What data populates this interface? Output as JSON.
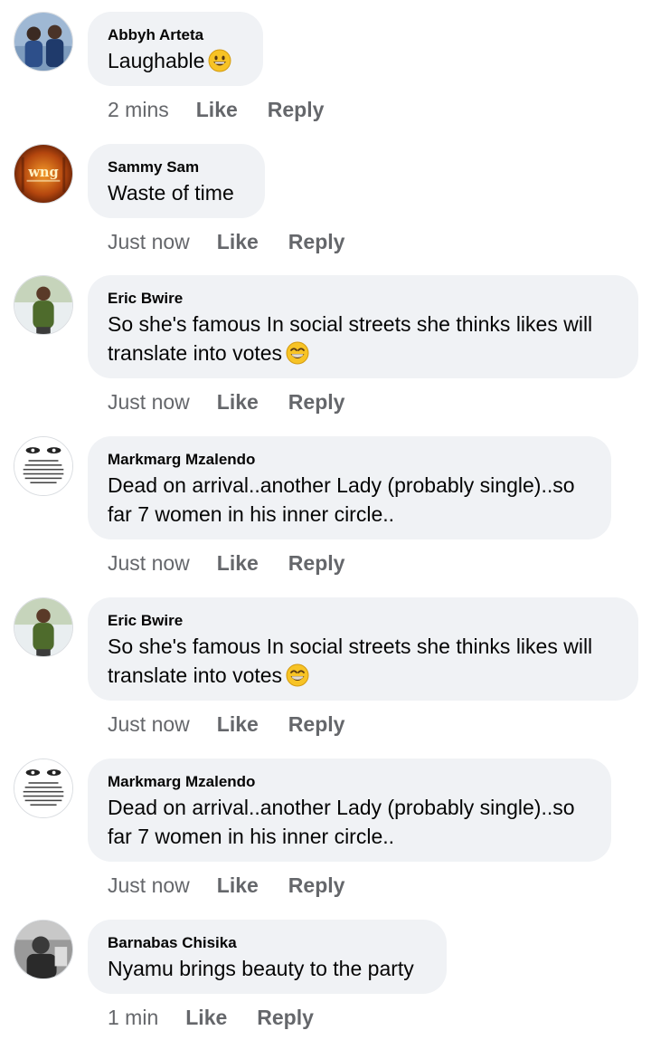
{
  "comments": [
    {
      "author": "Abbyh Arteta",
      "text": "Laughable",
      "emoji": "grinning-face",
      "time": "2 mins",
      "like": "Like",
      "reply": "Reply",
      "avatar": "avatar-two-men"
    },
    {
      "author": "Sammy Sam",
      "text": "Waste of time",
      "emoji": null,
      "time": "Just now",
      "like": "Like",
      "reply": "Reply",
      "avatar": "avatar-wng-logo"
    },
    {
      "author": "Eric Bwire",
      "text": "So she's famous In social streets she thinks likes will translate into votes",
      "emoji": "beaming-face-with-smiling-eyes",
      "time": "Just now",
      "like": "Like",
      "reply": "Reply",
      "avatar": "avatar-man-green"
    },
    {
      "author": "Markmarg Mzalendo",
      "text": "Dead on arrival..another Lady (probably single)..so far 7 women in his inner circle..",
      "emoji": null,
      "time": "Just now",
      "like": "Like",
      "reply": "Reply",
      "avatar": "avatar-eyes-quote"
    },
    {
      "author": "Eric Bwire",
      "text": "So she's famous In social streets she thinks likes will translate into votes",
      "emoji": "beaming-face-with-smiling-eyes",
      "time": "Just now",
      "like": "Like",
      "reply": "Reply",
      "avatar": "avatar-man-green"
    },
    {
      "author": "Markmarg Mzalendo",
      "text": "Dead on arrival..another Lady (probably single)..so far 7 women in his inner circle..",
      "emoji": null,
      "time": "Just now",
      "like": "Like",
      "reply": "Reply",
      "avatar": "avatar-eyes-quote"
    },
    {
      "author": "Barnabas Chisika",
      "text": "Nyamu brings beauty to the party",
      "emoji": null,
      "time": "1 min",
      "like": "Like",
      "reply": "Reply",
      "avatar": "avatar-gray-photo"
    }
  ],
  "colors": {
    "bubble": "#f0f2f5",
    "text": "#050505",
    "meta": "#65676b"
  }
}
